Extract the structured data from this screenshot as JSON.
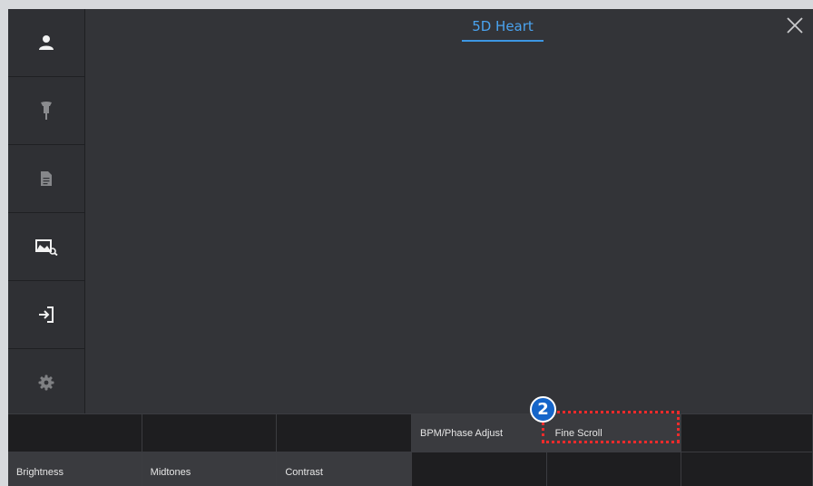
{
  "header": {
    "title": "5D Heart"
  },
  "sidebar": {
    "items": [
      {
        "icon": "patient-icon"
      },
      {
        "icon": "probe-icon"
      },
      {
        "icon": "report-icon"
      },
      {
        "icon": "review-icon"
      },
      {
        "icon": "exit-icon"
      },
      {
        "icon": "settings-icon"
      }
    ]
  },
  "softkeys": {
    "row1": [
      "",
      "",
      "",
      "BPM/Phase Adjust",
      "Fine Scroll",
      ""
    ],
    "row2": [
      "Brightness",
      "Midtones",
      "Contrast",
      "",
      "",
      ""
    ]
  },
  "annotation": {
    "step_number": "2",
    "color": "#ee2b2b"
  },
  "colors": {
    "accent": "#4aa3ef",
    "badge": "#1565c9"
  }
}
